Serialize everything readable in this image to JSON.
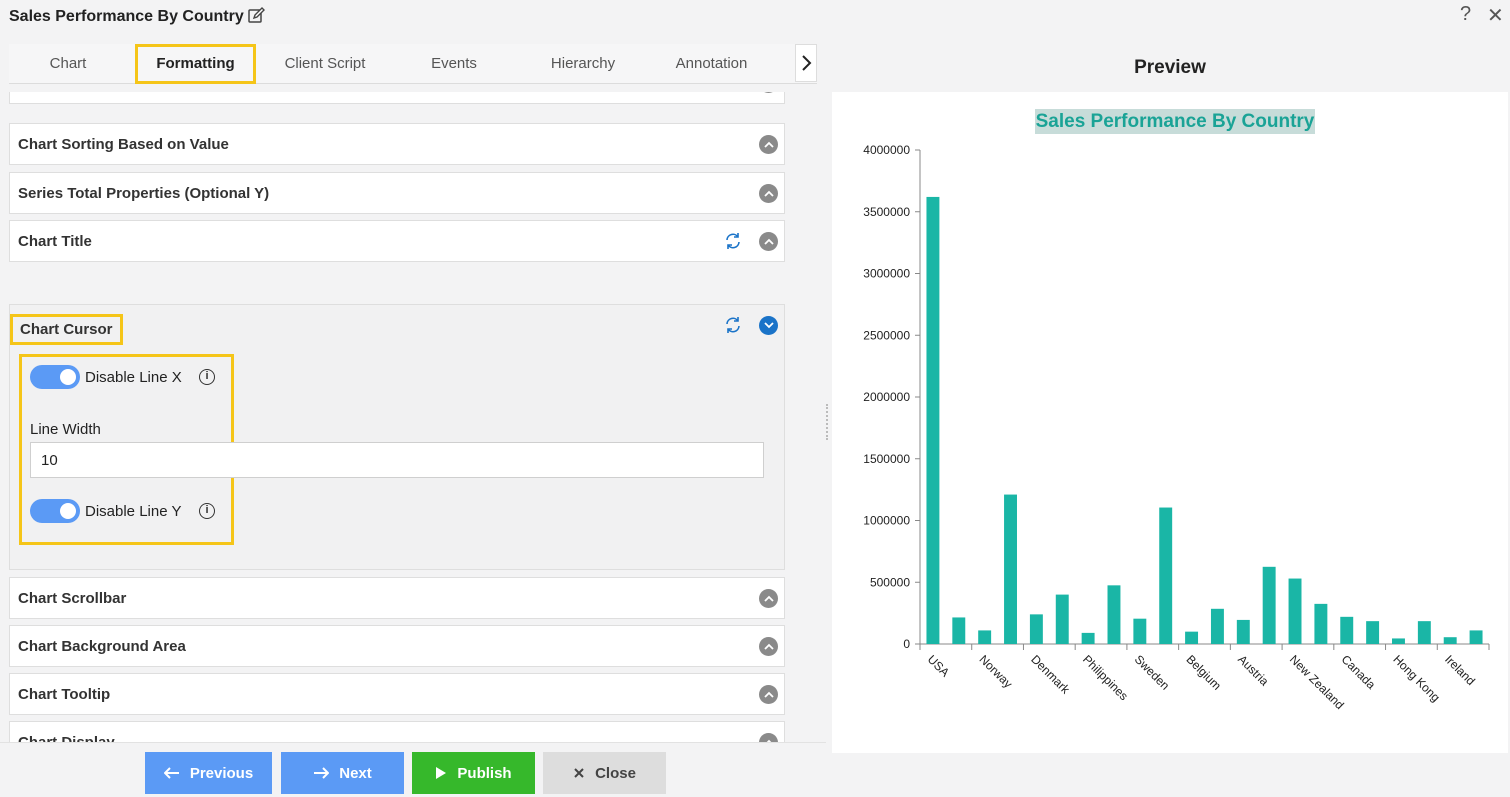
{
  "header": {
    "title": "Sales Performance By Country",
    "help": "?",
    "close": "✕"
  },
  "tabs": [
    {
      "label": "Chart",
      "active": false
    },
    {
      "label": "Formatting",
      "active": true
    },
    {
      "label": "Client Script",
      "active": false
    },
    {
      "label": "Events",
      "active": false
    },
    {
      "label": "Hierarchy",
      "active": false
    },
    {
      "label": "Annotation",
      "active": false
    }
  ],
  "sections": {
    "sorting": "Chart Sorting Based on Value",
    "series_total": "Series Total Properties (Optional Y)",
    "title": "Chart Title",
    "cursor": "Chart Cursor",
    "scrollbar": "Chart Scrollbar",
    "background": "Chart Background Area",
    "tooltip": "Chart Tooltip",
    "display": "Chart Display"
  },
  "cursor": {
    "disable_line_x": {
      "label": "Disable Line X",
      "on": true
    },
    "line_width": {
      "label": "Line Width",
      "value": "10"
    },
    "disable_line_y": {
      "label": "Disable Line Y",
      "on": true
    }
  },
  "footer": {
    "previous": "Previous",
    "next": "Next",
    "publish": "Publish",
    "close": "Close"
  },
  "preview": {
    "heading": "Preview"
  },
  "colors": {
    "bar": "#1ab6a6",
    "title": "#1aa396",
    "accent": "#5b9af5",
    "highlight": "#f5c518"
  },
  "chart_data": {
    "type": "bar",
    "title": "Sales Performance By Country",
    "xlabel": "",
    "ylabel": "",
    "ylim": [
      0,
      4000000
    ],
    "yticks": [
      0,
      500000,
      1000000,
      1500000,
      2000000,
      2500000,
      3000000,
      3500000,
      4000000
    ],
    "categories": [
      "USA",
      "",
      "Norway",
      "",
      "Denmark",
      "",
      "Philippines",
      "",
      "Sweden",
      "",
      "Belgium",
      "",
      "Austria",
      "",
      "New Zealand",
      "",
      "Canada",
      "",
      "Hong Kong",
      "",
      "Ireland",
      ""
    ],
    "values": [
      3620000,
      215000,
      110000,
      1210000,
      240000,
      400000,
      90000,
      475000,
      205000,
      1105000,
      100000,
      285000,
      195000,
      625000,
      530000,
      325000,
      220000,
      185000,
      45000,
      185000,
      55000,
      110000
    ]
  }
}
